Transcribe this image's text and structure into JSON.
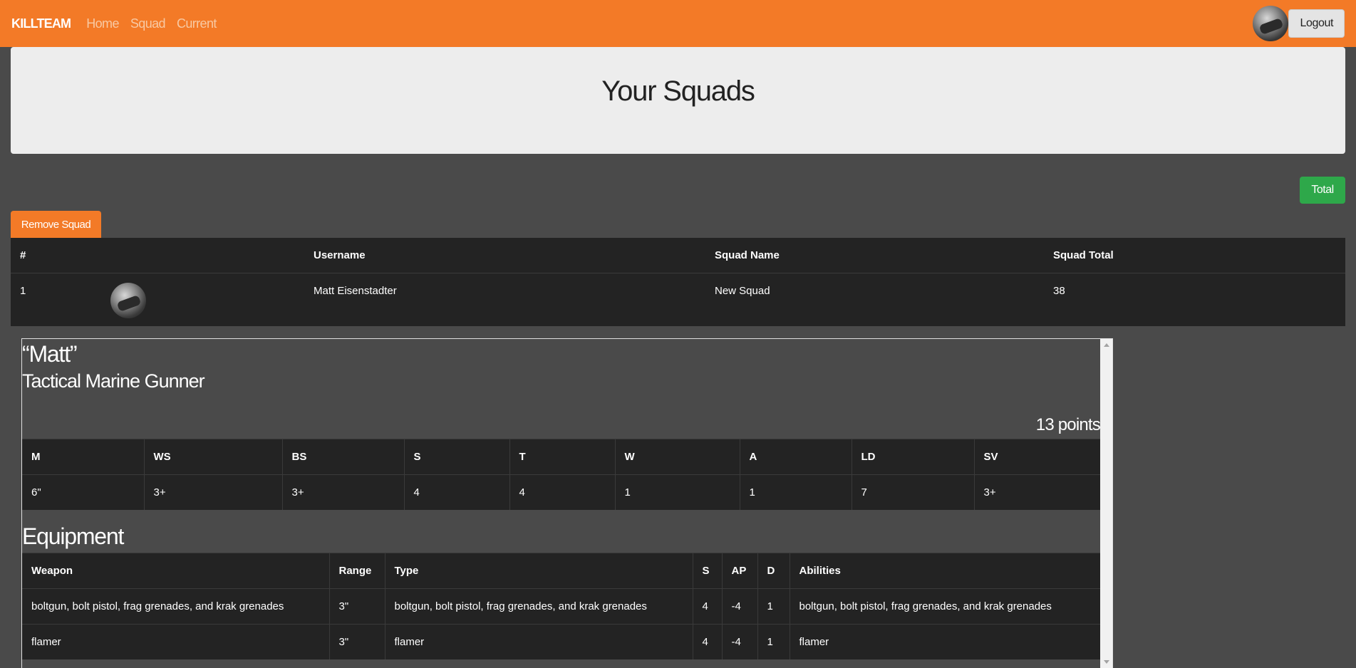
{
  "navbar": {
    "brand": "KILLTEAM",
    "links": [
      "Home",
      "Squad",
      "Current"
    ],
    "logout_label": "Logout"
  },
  "jumbotron": {
    "title": "Your Squads"
  },
  "actions": {
    "total_label": "Total",
    "remove_label": "Remove Squad"
  },
  "squad_table": {
    "headers": [
      "#",
      "",
      "Username",
      "Squad Name",
      "Squad Total"
    ],
    "rows": [
      {
        "num": "1",
        "username": "Matt Eisenstadter",
        "squad_name": "New Squad",
        "total": "38"
      }
    ]
  },
  "operative": {
    "name": "“Matt”",
    "type": "Tactical Marine Gunner",
    "points": "13 points",
    "stats": {
      "headers": [
        "M",
        "WS",
        "BS",
        "S",
        "T",
        "W",
        "A",
        "LD",
        "SV"
      ],
      "values": [
        "6\"",
        "3+",
        "3+",
        "4",
        "4",
        "1",
        "1",
        "7",
        "3+"
      ]
    },
    "equipment_title": "Equipment",
    "equipment": {
      "headers": [
        "Weapon",
        "Range",
        "Type",
        "S",
        "AP",
        "D",
        "Abilities"
      ],
      "rows": [
        [
          "boltgun, bolt pistol, frag grenades, and krak grenades",
          "3\"",
          "boltgun, bolt pistol, frag grenades, and krak grenades",
          "4",
          "-4",
          "1",
          "boltgun, bolt pistol, frag grenades, and krak grenades"
        ],
        [
          "flamer",
          "3\"",
          "flamer",
          "4",
          "-4",
          "1",
          "flamer"
        ]
      ]
    }
  },
  "colors": {
    "navbar": "#f37a27",
    "background": "#4a4a4a",
    "table": "#232323",
    "total_button": "#2ea84a",
    "jumbotron": "#ededed"
  }
}
